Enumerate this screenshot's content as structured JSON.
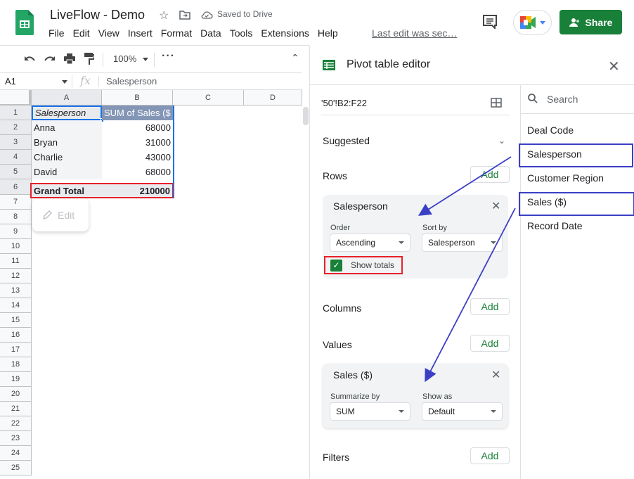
{
  "app": {
    "title": "LiveFlow - Demo",
    "saved_status": "Saved to Drive",
    "last_edit": "Last edit was sec…",
    "share_label": "Share",
    "menu": [
      "File",
      "Edit",
      "View",
      "Insert",
      "Format",
      "Data",
      "Tools",
      "Extensions",
      "Help"
    ],
    "brand_color": "#188038"
  },
  "toolbar": {
    "zoom": "100%"
  },
  "formula_bar": {
    "cell_ref": "A1",
    "fx": "fx",
    "value": "Salesperson"
  },
  "grid": {
    "columns": [
      "A",
      "B",
      "C",
      "D"
    ],
    "rows": [
      "1",
      "2",
      "3",
      "4",
      "5",
      "6",
      "7",
      "8",
      "9",
      "10",
      "11",
      "12",
      "13",
      "14",
      "15",
      "16",
      "17",
      "18",
      "19",
      "20",
      "21",
      "22",
      "23",
      "24",
      "25"
    ],
    "pivot": {
      "header": [
        "Salesperson",
        "SUM of Sales ($"
      ],
      "data": [
        [
          "Anna",
          "68000"
        ],
        [
          "Bryan",
          "31000"
        ],
        [
          "Charlie",
          "43000"
        ],
        [
          "David",
          "68000"
        ]
      ],
      "total": [
        "Grand Total",
        "210000"
      ]
    },
    "edit_popup": "Edit"
  },
  "pivot_editor": {
    "title": "Pivot table editor",
    "range": "'50'!B2:F22",
    "suggested": "Suggested",
    "rows_label": "Rows",
    "columns_label": "Columns",
    "values_label": "Values",
    "filters_label": "Filters",
    "add_label": "Add",
    "row_card": {
      "title": "Salesperson",
      "order_label": "Order",
      "order_value": "Ascending",
      "sort_label": "Sort by",
      "sort_value": "Salesperson",
      "show_totals_label": "Show totals",
      "show_totals_checked": true
    },
    "value_card": {
      "title": "Sales ($)",
      "summarize_label": "Summarize by",
      "summarize_value": "SUM",
      "show_as_label": "Show as",
      "show_as_value": "Default"
    },
    "field_search_placeholder": "Search",
    "fields": [
      "Deal Code",
      "Salesperson",
      "Customer Region",
      "Sales ($)",
      "Record Date"
    ],
    "annotation_color": "#3b3fc5",
    "highlight_color": "#e8202a"
  }
}
